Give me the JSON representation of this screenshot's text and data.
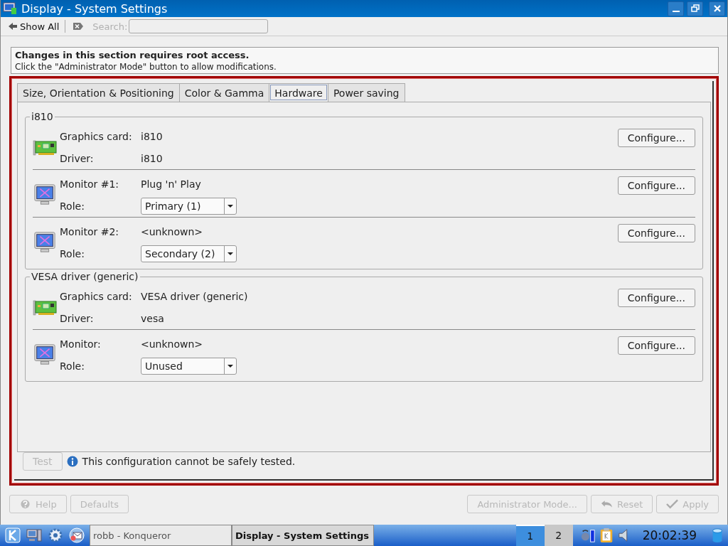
{
  "window": {
    "title": "Display - System Settings"
  },
  "toolbar": {
    "back_label": "Show All",
    "search_label": "Search:",
    "search_disabled": true
  },
  "notice": {
    "title": "Changes in this section requires root access.",
    "text": "Click the \"Administrator Mode\" button to allow modifications."
  },
  "tabs": [
    {
      "label": "Size, Orientation & Positioning",
      "selected": false
    },
    {
      "label": "Color & Gamma",
      "selected": false
    },
    {
      "label": "Hardware",
      "selected": true
    },
    {
      "label": "Power saving",
      "selected": false
    }
  ],
  "groups": [
    {
      "title": "i810",
      "rows": [
        {
          "kind": "card",
          "label": "Graphics card:",
          "value": "i810",
          "sub_label": "Driver:",
          "sub_value": "i810",
          "button": "Configure..."
        },
        {
          "kind": "monitor",
          "label": "Monitor #1:",
          "value": "Plug 'n' Play",
          "sub_label": "Role:",
          "role": "Primary (1)",
          "button": "Configure..."
        },
        {
          "kind": "monitor",
          "label": "Monitor #2:",
          "value": "<unknown>",
          "sub_label": "Role:",
          "role": "Secondary (2)",
          "button": "Configure..."
        }
      ]
    },
    {
      "title": "VESA driver (generic)",
      "rows": [
        {
          "kind": "card",
          "label": "Graphics card:",
          "value": "VESA driver (generic)",
          "sub_label": "Driver:",
          "sub_value": "vesa",
          "button": "Configure..."
        },
        {
          "kind": "monitor",
          "label": "Monitor:",
          "value": "<unknown>",
          "sub_label": "Role:",
          "role": "Unused",
          "button": "Configure..."
        }
      ]
    }
  ],
  "test_button": {
    "label": "Test",
    "disabled": true
  },
  "info": "This configuration cannot be safely tested.",
  "left_buttons": [
    {
      "label": "Help",
      "kind": "help",
      "disabled": true
    },
    {
      "label": "Defaults",
      "kind": "plain",
      "disabled": true
    }
  ],
  "right_buttons": [
    {
      "label": "Administrator Mode...",
      "kind": "plain",
      "disabled": true
    },
    {
      "label": "Reset",
      "kind": "reset",
      "disabled": true
    },
    {
      "label": "Apply",
      "kind": "apply",
      "disabled": true
    }
  ],
  "taskbar": {
    "tasks": [
      {
        "label": "robb - Konqueror",
        "selected": false
      },
      {
        "label": "Display - System Settings",
        "selected": true
      }
    ],
    "desktops": [
      {
        "label": "1",
        "selected": true
      },
      {
        "label": "2",
        "selected": false
      }
    ],
    "clock": "20:02:39"
  }
}
